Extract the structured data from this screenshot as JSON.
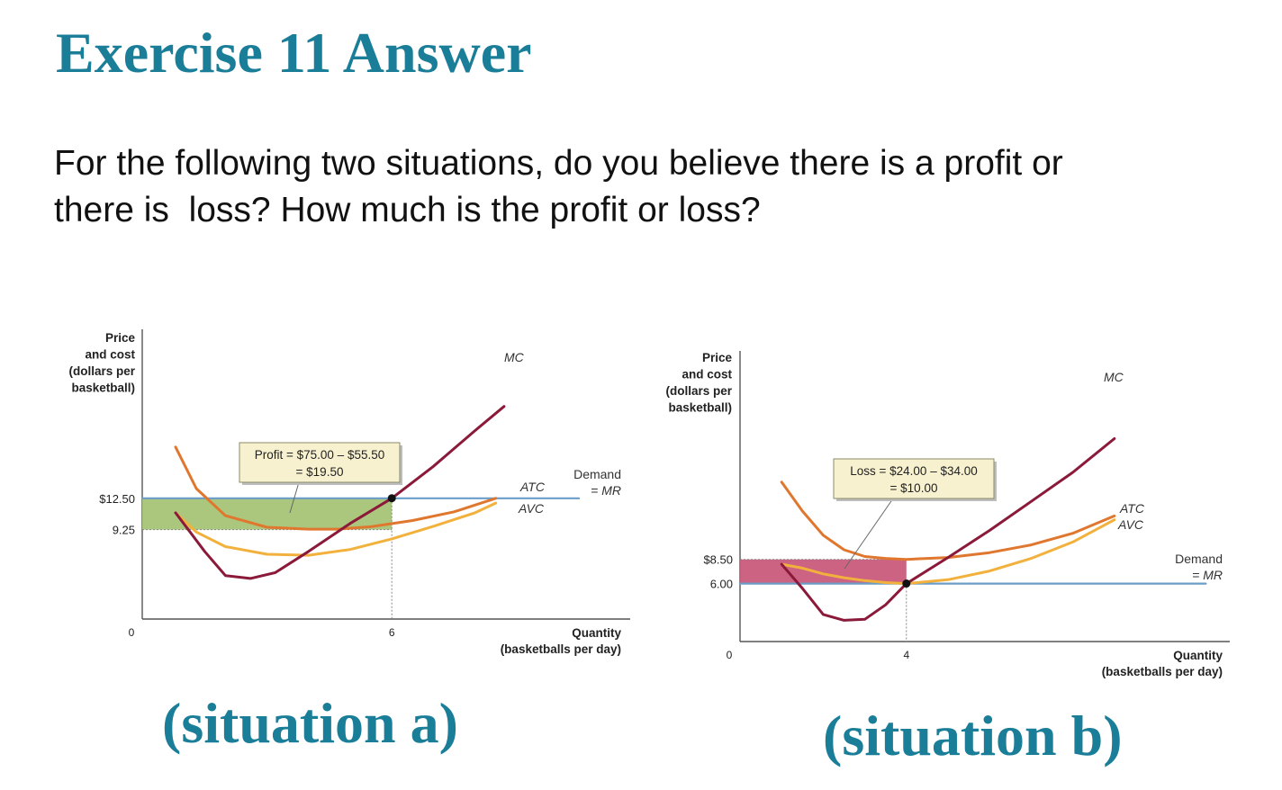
{
  "slide": {
    "title": "Exercise 11 Answer",
    "question_line1": "For the following two situations, do you believe there is a profit or",
    "question_line2": "there is  loss? How much is the profit or loss?"
  },
  "colors": {
    "heading": "#1a7e99",
    "mc": "#8b1a3a",
    "atc": "#e0772f",
    "avc": "#f2b13d",
    "demand": "#6b9dc9",
    "profit_area": "#a7c477",
    "loss_area": "#c95b7b",
    "annotation_box": "#f7f1cf"
  },
  "chart_data": [
    {
      "type": "line",
      "caption": "(situation a)",
      "ylabel": [
        "Price",
        "and cost",
        "(dollars per",
        "basketball)"
      ],
      "xlabel": [
        "Quantity",
        "(basketballs per day)"
      ],
      "xlim": [
        0,
        10.5
      ],
      "ylim": [
        0,
        22
      ],
      "ticks_y": [
        {
          "label": "$12.50",
          "value": 12.5
        },
        {
          "label": "9.25",
          "value": 9.25
        }
      ],
      "ticks_x": [
        {
          "label": "6",
          "value": 6
        }
      ],
      "origin_label": "0",
      "series": [
        {
          "name": "MC",
          "key": "mc",
          "x": [
            0.8,
            1.5,
            2.0,
            2.6,
            3.2,
            4.0,
            5.0,
            6.0,
            7.0,
            8.0,
            8.7
          ],
          "y": [
            11.0,
            7.0,
            4.5,
            4.2,
            4.8,
            7.0,
            9.9,
            12.5,
            15.8,
            19.5,
            22.0
          ]
        },
        {
          "name": "ATC",
          "key": "atc",
          "x": [
            0.8,
            1.3,
            2.0,
            3.0,
            4.0,
            4.7,
            5.5,
            6.5,
            7.5,
            8.5
          ],
          "y": [
            17.8,
            13.5,
            10.7,
            9.5,
            9.3,
            9.3,
            9.55,
            10.2,
            11.1,
            12.5
          ]
        },
        {
          "name": "AVC",
          "key": "avc",
          "x": [
            0.8,
            1.3,
            2.0,
            3.0,
            4.0,
            5.0,
            6.0,
            7.0,
            8.0,
            8.5
          ],
          "y": [
            11.0,
            9.0,
            7.5,
            6.7,
            6.6,
            7.2,
            8.3,
            9.6,
            11.0,
            12.0
          ]
        },
        {
          "name": "Demand = MR",
          "key": "demand",
          "x": [
            0,
            10.5
          ],
          "y": [
            12.5,
            12.5
          ]
        }
      ],
      "series_labels": {
        "mc": "MC",
        "atc": "ATC",
        "avc": "AVC",
        "demand_line1": "Demand",
        "demand_line2": "= MR"
      },
      "area": {
        "x": [
          0,
          6
        ],
        "y": [
          9.25,
          12.5
        ],
        "kind": "profit"
      },
      "annotation": {
        "line1": "Profit = $75.00 – $55.50",
        "line2": "= $19.50"
      },
      "point": {
        "x": 6,
        "y": 12.5
      }
    },
    {
      "type": "line",
      "caption": "(situation b)",
      "ylabel": [
        "Price",
        "and cost",
        "(dollars per",
        "basketball)"
      ],
      "xlabel": [
        "Quantity",
        "(basketballs per day)"
      ],
      "xlim": [
        0,
        10.5
      ],
      "ylim": [
        0,
        22
      ],
      "ticks_y": [
        {
          "label": "$8.50",
          "value": 8.5
        },
        {
          "label": "6.00",
          "value": 6.0
        }
      ],
      "ticks_x": [
        {
          "label": "4",
          "value": 4
        }
      ],
      "origin_label": "0",
      "series": [
        {
          "name": "MC",
          "key": "mc",
          "x": [
            1.0,
            1.5,
            2.0,
            2.5,
            3.0,
            3.5,
            4.0,
            5.0,
            6.0,
            7.0,
            8.0,
            9.0
          ],
          "y": [
            8.0,
            5.5,
            2.8,
            2.2,
            2.3,
            3.8,
            6.0,
            8.7,
            11.5,
            14.5,
            17.5,
            21.0
          ]
        },
        {
          "name": "ATC",
          "key": "atc",
          "x": [
            1.0,
            1.5,
            2.0,
            2.5,
            3.0,
            3.5,
            4.0,
            5.0,
            6.0,
            7.0,
            8.0,
            9.0
          ],
          "y": [
            16.5,
            13.5,
            11.0,
            9.5,
            8.8,
            8.6,
            8.5,
            8.7,
            9.2,
            10.0,
            11.2,
            13.0
          ]
        },
        {
          "name": "AVC",
          "key": "avc",
          "x": [
            1.0,
            1.5,
            2.0,
            2.5,
            3.0,
            3.5,
            4.0,
            5.0,
            6.0,
            7.0,
            8.0,
            9.0
          ],
          "y": [
            8.0,
            7.6,
            7.0,
            6.6,
            6.3,
            6.1,
            6.0,
            6.4,
            7.3,
            8.6,
            10.3,
            12.6
          ]
        },
        {
          "name": "Demand = MR",
          "key": "demand",
          "x": [
            0,
            11.2
          ],
          "y": [
            6.0,
            6.0
          ]
        }
      ],
      "series_labels": {
        "mc": "MC",
        "atc": "ATC",
        "avc": "AVC",
        "demand_line1": "Demand",
        "demand_line2": "= MR"
      },
      "area": {
        "x": [
          0,
          4
        ],
        "y": [
          6.0,
          8.5
        ],
        "kind": "loss"
      },
      "annotation": {
        "line1": "Loss = $24.00 – $34.00",
        "line2": "= $10.00"
      },
      "point": {
        "x": 4,
        "y": 6.0
      }
    }
  ]
}
